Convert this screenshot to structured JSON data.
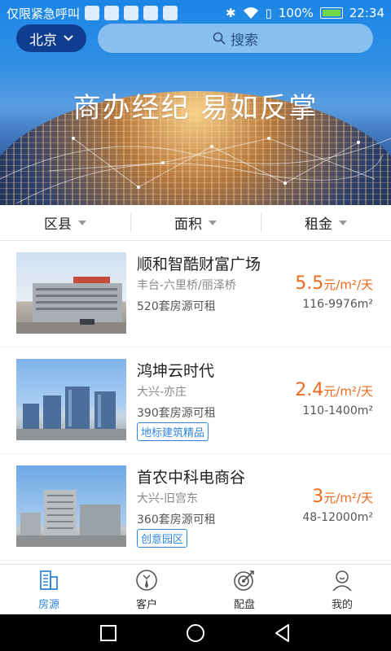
{
  "status_bar": {
    "carrier": "仅限紧急呼叫",
    "battery": "100%",
    "time": "22:34"
  },
  "header": {
    "city": "北京",
    "search_placeholder": "搜索",
    "slogan": "商办经纪 易如反掌"
  },
  "filters": [
    {
      "label": "区县"
    },
    {
      "label": "面积"
    },
    {
      "label": "租金"
    }
  ],
  "listings": [
    {
      "name": "顺和智酷财富广场",
      "area": "丰台-六里桥/丽泽桥",
      "count": "520套房源可租",
      "price": "5.5",
      "unit": "元/m²/天",
      "size": "116-9976m²",
      "tag": ""
    },
    {
      "name": "鸿坤云时代",
      "area": "大兴-亦庄",
      "count": "390套房源可租",
      "price": "2.4",
      "unit": "元/m²/天",
      "size": "110-1400m²",
      "tag": "地标建筑精品"
    },
    {
      "name": "首农中科电商谷",
      "area": "大兴-旧宫东",
      "count": "360套房源可租",
      "price": "3",
      "unit": "元/m²/天",
      "size": "48-12000m²",
      "tag": "创意园区"
    }
  ],
  "tabs": [
    {
      "label": "房源",
      "icon": "building-icon",
      "active": true
    },
    {
      "label": "客户",
      "icon": "customer-icon"
    },
    {
      "label": "配盘",
      "icon": "target-icon"
    },
    {
      "label": "我的",
      "icon": "profile-icon"
    }
  ],
  "colors": {
    "accent": "#2f86e0",
    "price": "#f06a1d",
    "city_button": "#0f3d8f"
  }
}
